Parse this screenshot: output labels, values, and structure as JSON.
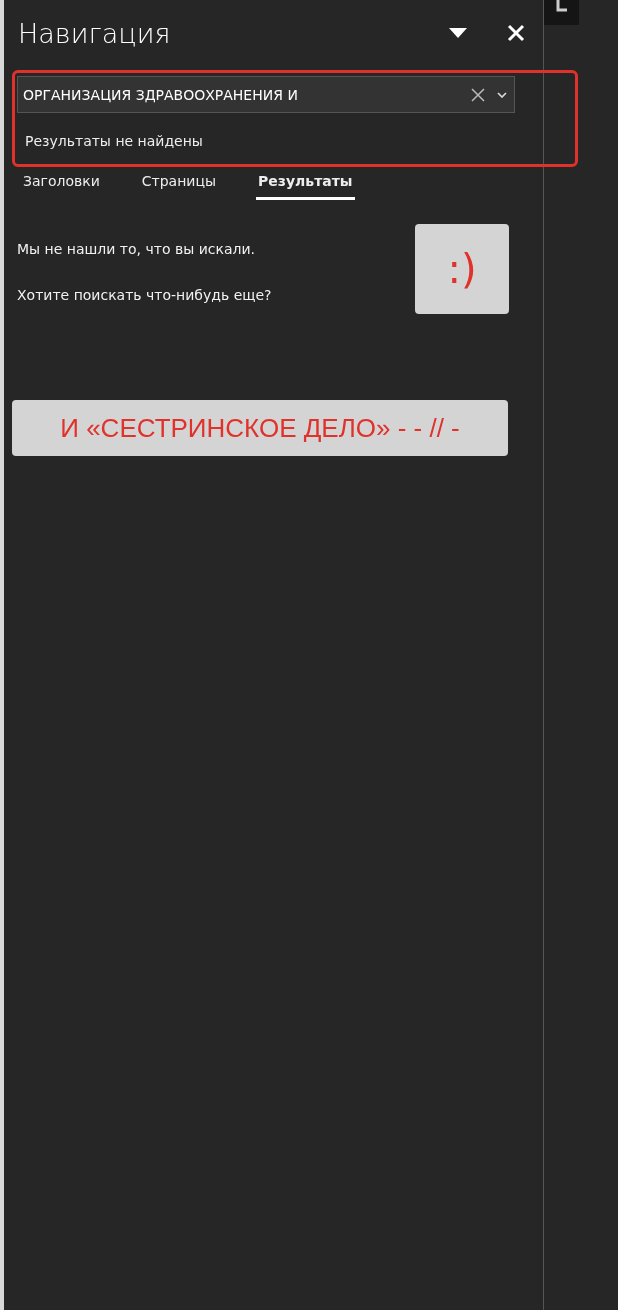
{
  "panel": {
    "title": "Навигация"
  },
  "search": {
    "value": "ОРГАНИЗАЦИЯ ЗДРАВООХРАНЕНИЯ И",
    "status": "Результаты не найдены"
  },
  "tabs": [
    {
      "label": "Заголовки",
      "selected": false
    },
    {
      "label": "Страницы",
      "selected": false
    },
    {
      "label": "Результаты",
      "selected": true
    }
  ],
  "message": {
    "lines": [
      "Мы не нашли то, что вы искали.",
      "Хотите поискать что-нибудь еще?"
    ],
    "emoticon": ":)"
  },
  "banner": "И «СЕСТРИНСКОЕ ДЕЛО» - - // -"
}
